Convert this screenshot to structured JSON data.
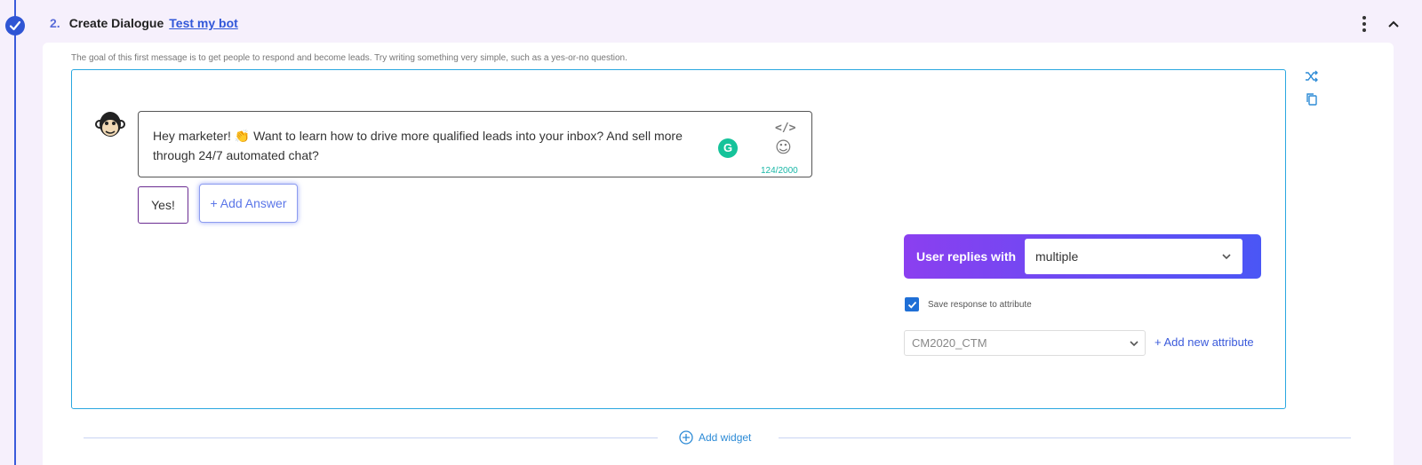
{
  "step": {
    "number": "2.",
    "title": "Create Dialogue",
    "link": "Test my bot"
  },
  "hint": "The goal of this first message is to get people to respond and become leads. Try writing something very simple, such as a yes-or-no question.",
  "message": {
    "text": "Hey marketer! 👏 Want to learn how to drive more qualified leads into your inbox? And sell more through 24/7 automated chat?",
    "counter": "124/2000",
    "code_symbol": "</>",
    "grammarly_letter": "G"
  },
  "answers": {
    "items": [
      "Yes!"
    ],
    "add_label": "+ Add Answer"
  },
  "replies": {
    "label": "User replies with",
    "selected": "multiple"
  },
  "save_response": {
    "label": "Save response to attribute",
    "checked": true
  },
  "attribute": {
    "selected": "CM2020_CTM",
    "add_label": "+ Add new attribute"
  },
  "add_widget": "Add widget",
  "colors": {
    "accent": "#3b5bdb",
    "gradient_start": "#8b3ff0",
    "gradient_end": "#4a56f5",
    "counter": "#1ab7a7",
    "box_border": "#2aa7e0"
  }
}
